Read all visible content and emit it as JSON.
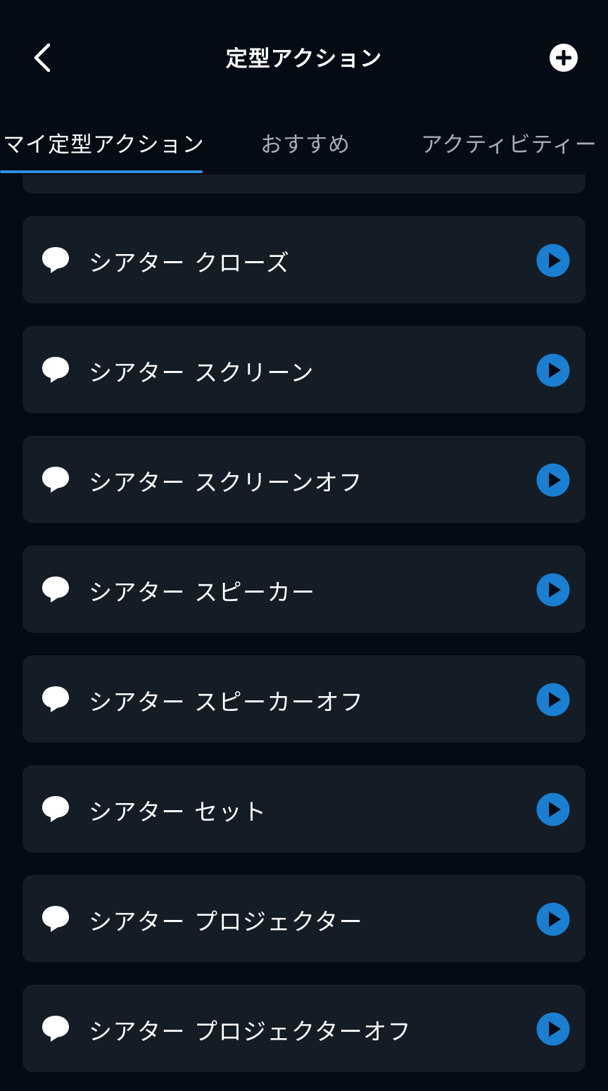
{
  "header": {
    "title": "定型アクション",
    "back_icon": "chevron-left-icon",
    "add_icon": "plus-circle-icon"
  },
  "tabs": [
    {
      "label": "マイ定型アクション",
      "active": true
    },
    {
      "label": "おすすめ",
      "active": false
    },
    {
      "label": "アクティビティー",
      "active": false
    }
  ],
  "routines": [
    {
      "label": "シアター クローズ"
    },
    {
      "label": "シアター スクリーン"
    },
    {
      "label": "シアター スクリーンオフ"
    },
    {
      "label": "シアター スピーカー"
    },
    {
      "label": "シアター スピーカーオフ"
    },
    {
      "label": "シアター セット"
    },
    {
      "label": "シアター プロジェクター"
    },
    {
      "label": "シアター プロジェクターオフ"
    }
  ],
  "colors": {
    "background": "#050b14",
    "card": "#141c26",
    "accent": "#2f8fe0",
    "play_button": "#1a7fd0"
  }
}
